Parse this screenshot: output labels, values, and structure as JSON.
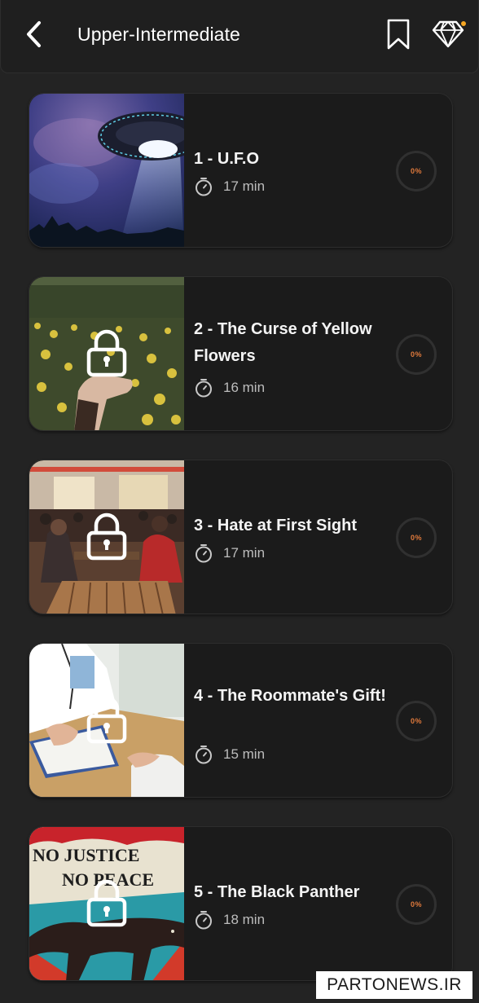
{
  "header": {
    "title": "Upper-Intermediate",
    "back_icon": "chevron-left-icon",
    "bookmark_icon": "bookmark-icon",
    "premium_icon": "diamond-icon",
    "notification_dot_color": "#f5a623"
  },
  "stories": [
    {
      "title": "1 - U.F.O",
      "duration": "17 min",
      "progress": "0%",
      "locked": false,
      "image": "ufo-image"
    },
    {
      "title": "2 - The Curse of Yellow Flowers",
      "duration": "16 min",
      "progress": "0%",
      "locked": true,
      "image": "yellow-flowers-image"
    },
    {
      "title": "3 - Hate at First Sight",
      "duration": "17 min",
      "progress": "0%",
      "locked": true,
      "image": "cafe-couple-image"
    },
    {
      "title": "4 - The Roommate's Gift!",
      "duration": "15 min",
      "progress": "0%",
      "locked": true,
      "image": "doctor-patient-image"
    },
    {
      "title": "5 - The Black Panther",
      "duration": "18 min",
      "progress": "0%",
      "locked": true,
      "image": "black-panther-poster-image"
    }
  ],
  "poster_text": "NO JUSTICE NO PEACE",
  "watermark": "PARTONEWS.IR",
  "colors": {
    "background": "#232323",
    "card": "#1b1b1b",
    "progress_text": "#e07a3c"
  }
}
